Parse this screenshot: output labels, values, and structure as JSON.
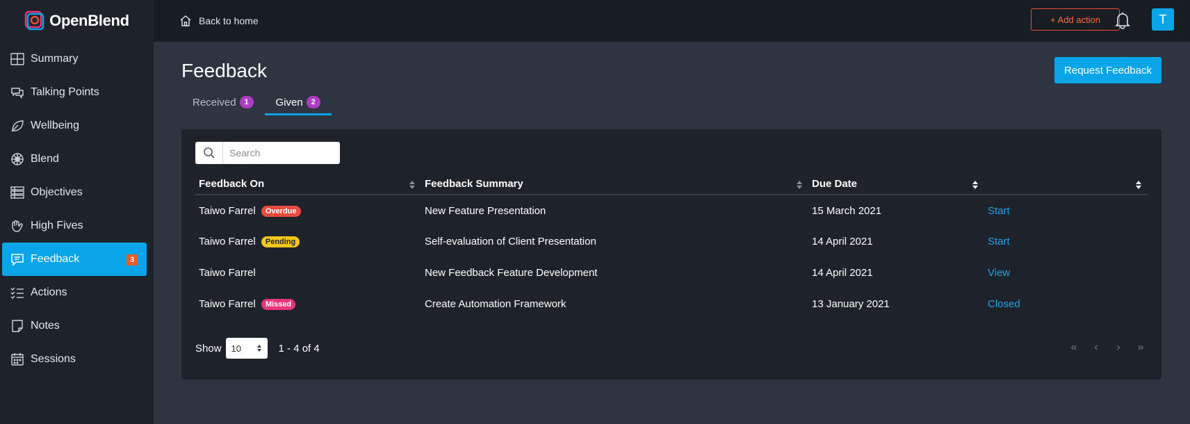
{
  "app": {
    "name": "OpenBlend"
  },
  "sidebar": {
    "items": [
      {
        "label": "Summary",
        "icon": "grid-icon"
      },
      {
        "label": "Talking Points",
        "icon": "chat-bubbles-icon"
      },
      {
        "label": "Wellbeing",
        "icon": "leaf-icon"
      },
      {
        "label": "Blend",
        "icon": "blend-icon"
      },
      {
        "label": "Objectives",
        "icon": "objectives-icon"
      },
      {
        "label": "High Fives",
        "icon": "high-five-icon"
      },
      {
        "label": "Feedback",
        "icon": "feedback-icon",
        "badge": "3",
        "active": true
      },
      {
        "label": "Actions",
        "icon": "checklist-icon"
      },
      {
        "label": "Notes",
        "icon": "note-icon"
      },
      {
        "label": "Sessions",
        "icon": "calendar-icon"
      }
    ]
  },
  "topbar": {
    "back_label": "Back to home",
    "add_action_label": "+ Add action",
    "avatar_initial": "T"
  },
  "page": {
    "title": "Feedback",
    "request_button": "Request Feedback",
    "tabs": [
      {
        "label": "Received",
        "count": "1",
        "active": false
      },
      {
        "label": "Given",
        "count": "2",
        "active": true
      }
    ]
  },
  "search": {
    "placeholder": "Search"
  },
  "table": {
    "columns": [
      "Feedback On",
      "Feedback Summary",
      "Due Date",
      ""
    ],
    "rows": [
      {
        "name": "Taiwo Farrel",
        "status": "Overdue",
        "summary": "New Feature Presentation",
        "due": "15 March 2021",
        "action": "Start"
      },
      {
        "name": "Taiwo Farrel",
        "status": "Pending",
        "summary": "Self-evaluation of Client Presentation",
        "due": "14 April 2021",
        "action": "Start"
      },
      {
        "name": "Taiwo Farrel",
        "status": "",
        "summary": "New Feedback Feature Development",
        "due": "14 April 2021",
        "action": "View"
      },
      {
        "name": "Taiwo Farrel",
        "status": "Missed",
        "summary": "Create Automation Framework",
        "due": "13 January 2021",
        "action": "Closed"
      }
    ]
  },
  "pagination": {
    "show_label": "Show",
    "page_size": "10",
    "range": "1 - 4 of 4"
  },
  "colors": {
    "accent": "#0aa4e8",
    "overdue": "#e94c3d",
    "pending": "#f5c518",
    "missed": "#e8357a",
    "add_action": "#e5532b"
  }
}
